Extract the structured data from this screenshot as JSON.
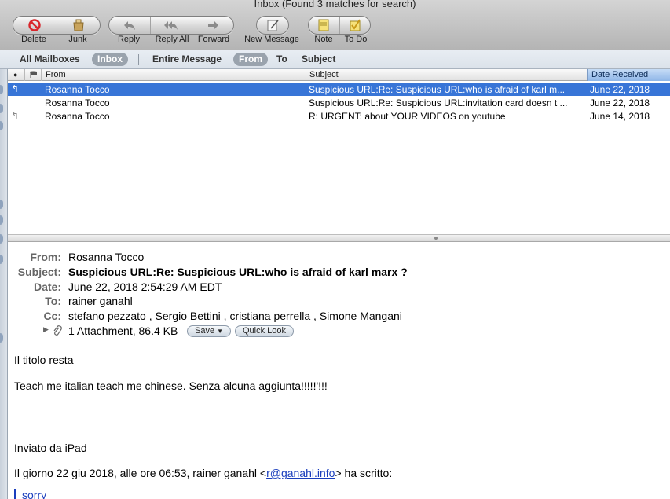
{
  "window": {
    "title": "Inbox (Found 3 matches for search)"
  },
  "toolbar": {
    "delete": "Delete",
    "junk": "Junk",
    "reply": "Reply",
    "reply_all": "Reply All",
    "forward": "Forward",
    "new_message": "New Message",
    "note": "Note",
    "todo": "To Do"
  },
  "search_scope": {
    "all_mailboxes": "All Mailboxes",
    "inbox": "Inbox",
    "entire_message": "Entire Message",
    "from": "From",
    "to": "To",
    "subject": "Subject"
  },
  "list": {
    "columns": {
      "from": "From",
      "subject": "Subject",
      "date": "Date Received"
    },
    "rows": [
      {
        "from": "Rosanna Tocco",
        "subject": "Suspicious URL:Re: Suspicious URL:who is afraid of karl m...",
        "date": "June 22, 2018",
        "selected": true,
        "icon": "replied-icon"
      },
      {
        "from": "Rosanna Tocco",
        "subject": "Suspicious URL:Re: Suspicious URL:invitation card doesn t ...",
        "date": "June 22, 2018",
        "selected": false,
        "icon": ""
      },
      {
        "from": "Rosanna Tocco",
        "subject": "R: URGENT: about YOUR VIDEOS on youtube",
        "date": "June 14, 2018",
        "selected": false,
        "icon": "replied-icon"
      }
    ]
  },
  "message": {
    "labels": {
      "from": "From:",
      "subject": "Subject:",
      "date": "Date:",
      "to": "To:",
      "cc": "Cc:"
    },
    "from": "Rosanna Tocco",
    "subject": "Suspicious URL:Re: Suspicious URL:who is afraid of karl marx ?",
    "date": "June 22, 2018 2:54:29 AM EDT",
    "to": "rainer ganahl",
    "cc": "stefano pezzato ,  Sergio Bettini ,  cristiana perrella ,  Simone Mangani",
    "attachment": "1 Attachment, 86.4 KB",
    "save_label": "Save",
    "quicklook_label": "Quick Look",
    "body": {
      "line1": "Il titolo resta",
      "line2": "Teach me italian teach me chinese.  Senza alcuna aggiunta!!!!!'!!!",
      "line3": "Inviato da iPad",
      "line4_prefix": "Il giorno 22 giu 2018, alle ore 06:53, rainer ganahl <",
      "line4_email": "r@ganahl.info",
      "line4_suffix": "> ha scritto:",
      "quote": "sorry"
    }
  },
  "colors": {
    "selection": "#3875d7",
    "link": "#1a3ebd",
    "delete_red": "#d9262b"
  }
}
